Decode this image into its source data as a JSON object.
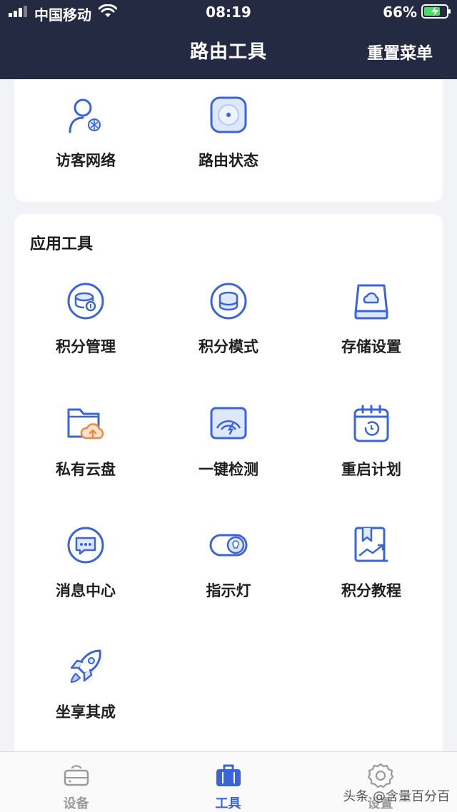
{
  "status_bar": {
    "carrier": "中国移动",
    "time": "08:19",
    "battery": "66%"
  },
  "nav": {
    "title": "路由工具",
    "action": "重置菜单"
  },
  "top_section": {
    "items": [
      {
        "label": "访客网络",
        "icon": "guest-user-icon"
      },
      {
        "label": "路由状态",
        "icon": "router-status-icon"
      }
    ]
  },
  "tools_section": {
    "title": "应用工具",
    "items": [
      {
        "label": "积分管理",
        "icon": "points-manage-icon"
      },
      {
        "label": "积分模式",
        "icon": "points-mode-icon"
      },
      {
        "label": "存储设置",
        "icon": "storage-icon"
      },
      {
        "label": "私有云盘",
        "icon": "cloud-folder-icon"
      },
      {
        "label": "一键检测",
        "icon": "speed-check-icon"
      },
      {
        "label": "重启计划",
        "icon": "calendar-restart-icon"
      },
      {
        "label": "消息中心",
        "icon": "message-icon"
      },
      {
        "label": "指示灯",
        "icon": "indicator-light-icon"
      },
      {
        "label": "积分教程",
        "icon": "tutorial-icon"
      },
      {
        "label": "坐享其成",
        "icon": "rocket-icon"
      }
    ]
  },
  "tabbar": {
    "tabs": [
      {
        "label": "设备",
        "icon": "router-device-icon"
      },
      {
        "label": "工具",
        "icon": "toolbox-icon"
      },
      {
        "label": "设置",
        "icon": "gear-icon"
      }
    ],
    "active": "工具"
  },
  "watermark": "头条 @含量百分百",
  "colors": {
    "header": "#252a43",
    "accent": "#3a64d8",
    "icon_light": "#dfe7fb",
    "icon_orange": "#f0883e"
  }
}
